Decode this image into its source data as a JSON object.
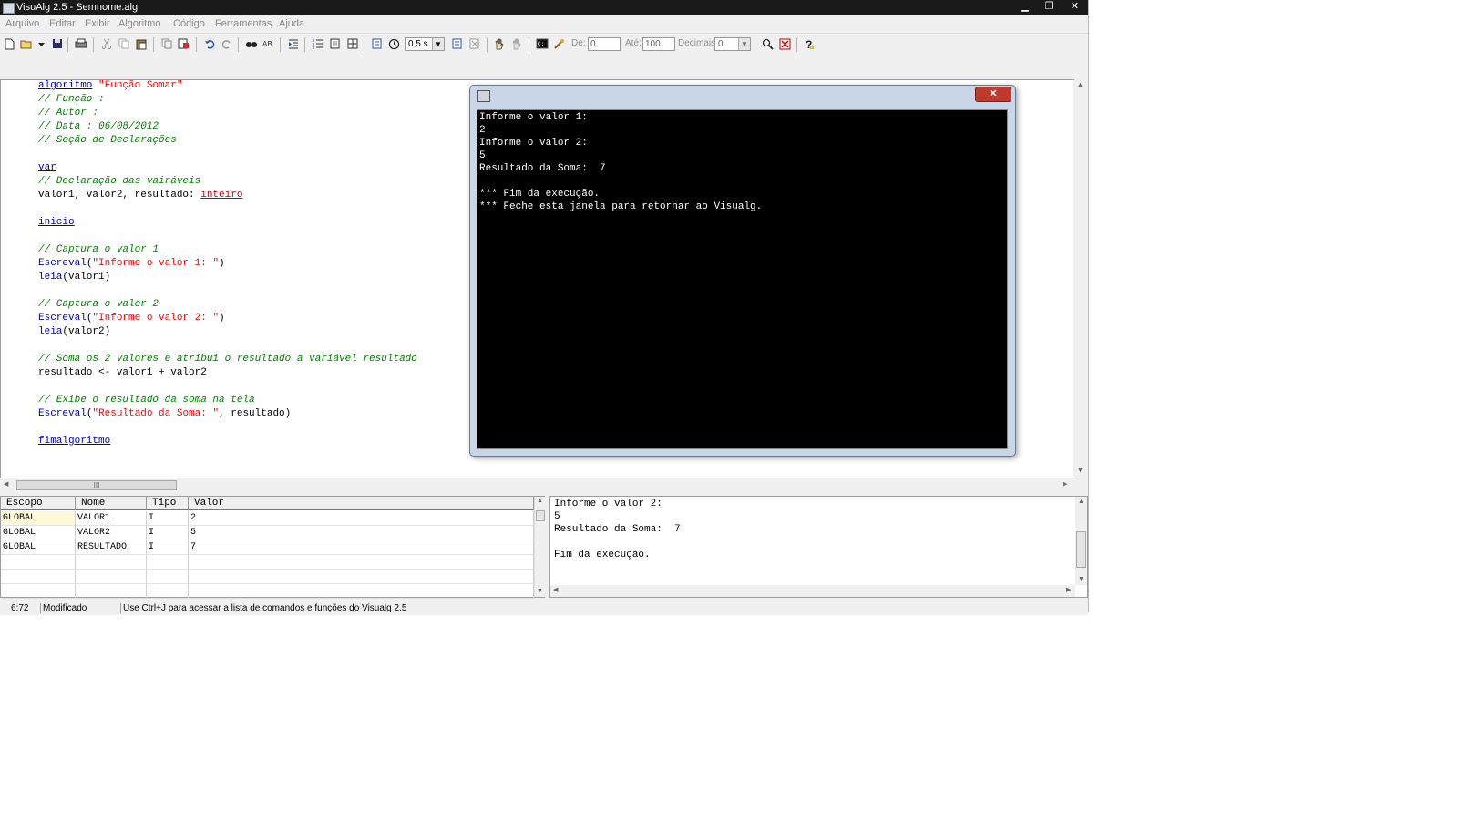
{
  "window": {
    "title": "VisuAlg 2.5 - Semnome.alg",
    "controls": {
      "minimize": "▁",
      "maximize": "❐",
      "close": "✕"
    }
  },
  "menu": [
    "Arquivo",
    "Editar",
    "Exibir",
    "Algoritmo",
    "Código",
    "Ferramentas",
    "Ajuda"
  ],
  "toolbar": {
    "speed": "0,5 s",
    "de_label": "De:",
    "de_value": "0",
    "ate_label": "Até:",
    "ate_value": "100",
    "decimais_label": "Decimais:",
    "decimais_value": "0"
  },
  "editor": {
    "lines": [
      {
        "tokens": [
          [
            "kw",
            "algoritmo"
          ],
          [
            "pl",
            " "
          ],
          [
            "st",
            "\"Função Somar\""
          ]
        ]
      },
      {
        "tokens": [
          [
            "cm",
            "// Função :"
          ]
        ]
      },
      {
        "tokens": [
          [
            "cm",
            "// Autor :"
          ]
        ]
      },
      {
        "tokens": [
          [
            "cm",
            "// Data : 06/08/2012"
          ]
        ]
      },
      {
        "tokens": [
          [
            "cm",
            "// Seção de Declarações"
          ]
        ]
      },
      {
        "tokens": []
      },
      {
        "tokens": [
          [
            "kw",
            "var"
          ]
        ]
      },
      {
        "tokens": [
          [
            "cm",
            "// Declaração das vairáveis"
          ]
        ]
      },
      {
        "tokens": [
          [
            "pl",
            "valor1, valor2, resultado: "
          ],
          [
            "ty",
            "inteiro"
          ]
        ]
      },
      {
        "tokens": []
      },
      {
        "tokens": [
          [
            "kw",
            "inicio"
          ]
        ]
      },
      {
        "tokens": []
      },
      {
        "tokens": [
          [
            "cm",
            "// Captura o valor 1"
          ]
        ]
      },
      {
        "tokens": [
          [
            "fn",
            "Escreval"
          ],
          [
            "pl",
            "("
          ],
          [
            "st",
            "\"Informe o valor 1: \""
          ],
          [
            "pl",
            ")"
          ]
        ]
      },
      {
        "tokens": [
          [
            "fn",
            "leia"
          ],
          [
            "pl",
            "(valor1)"
          ]
        ]
      },
      {
        "tokens": []
      },
      {
        "tokens": [
          [
            "cm",
            "// Captura o valor 2"
          ]
        ]
      },
      {
        "tokens": [
          [
            "fn",
            "Escreval"
          ],
          [
            "pl",
            "("
          ],
          [
            "st",
            "\"Informe o valor 2: \""
          ],
          [
            "pl",
            ")"
          ]
        ]
      },
      {
        "tokens": [
          [
            "fn",
            "leia"
          ],
          [
            "pl",
            "(valor2)"
          ]
        ]
      },
      {
        "tokens": []
      },
      {
        "tokens": [
          [
            "cm",
            "// Soma os 2 valores e atribui o resultado a variável resultado"
          ]
        ]
      },
      {
        "tokens": [
          [
            "pl",
            "resultado <- valor1 + valor2"
          ]
        ]
      },
      {
        "tokens": []
      },
      {
        "tokens": [
          [
            "cm",
            "// Exibe o resultado da soma na tela"
          ]
        ]
      },
      {
        "tokens": [
          [
            "fn",
            "Escreval"
          ],
          [
            "pl",
            "("
          ],
          [
            "st",
            "\"Resultado da Soma: \""
          ],
          [
            "pl",
            ", resultado)"
          ]
        ]
      },
      {
        "tokens": []
      },
      {
        "tokens": [
          [
            "kw",
            "fimalgoritmo"
          ]
        ]
      }
    ],
    "hscroll_grip": "III"
  },
  "console": {
    "close": "✕",
    "lines": [
      "Informe o valor 1:",
      "2",
      "Informe o valor 2:",
      "5",
      "Resultado da Soma:  7",
      "",
      "*** Fim da execução.",
      "*** Feche esta janela para retornar ao Visualg."
    ]
  },
  "variables": {
    "headers": [
      "Escopo",
      "Nome",
      "Tipo",
      "Valor"
    ],
    "rows": [
      [
        "GLOBAL",
        "VALOR1",
        "I",
        "2"
      ],
      [
        "GLOBAL",
        "VALOR2",
        "I",
        "5"
      ],
      [
        "GLOBAL",
        "RESULTADO",
        "I",
        "7"
      ]
    ]
  },
  "output": {
    "lines": [
      "Informe o valor 2:",
      "5",
      "Resultado da Soma:  7",
      "",
      "Fim da execução."
    ]
  },
  "status": {
    "position": "6:72",
    "state": "Modificado",
    "hint": "Use Ctrl+J para acessar a lista de comandos e funções do Visualg 2.5"
  }
}
